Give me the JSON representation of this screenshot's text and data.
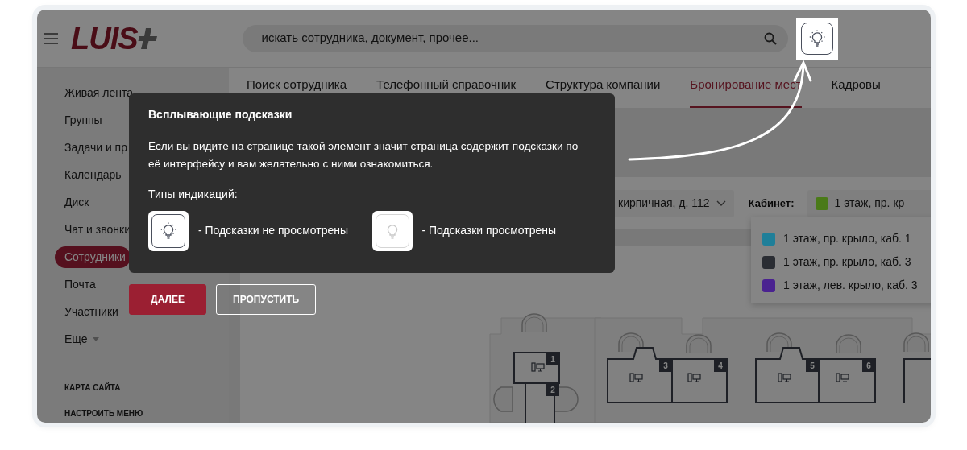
{
  "header": {
    "logo": "LUIS",
    "search": {
      "placeholder": "искать сотрудника, документ, прочее..."
    },
    "hints_button": {
      "viewed": false
    }
  },
  "sidebar": {
    "items": [
      {
        "label": "Живая лента",
        "selected": false,
        "dropdown": false
      },
      {
        "label": "Группы",
        "selected": false,
        "dropdown": false
      },
      {
        "label": "Задачи и пр",
        "selected": false,
        "dropdown": false
      },
      {
        "label": "Календарь",
        "selected": false,
        "dropdown": false
      },
      {
        "label": "Диск",
        "selected": false,
        "dropdown": false
      },
      {
        "label": "Чат и звонки",
        "selected": false,
        "dropdown": false
      },
      {
        "label": "Сотрудники",
        "selected": true,
        "dropdown": false
      },
      {
        "label": "Почта",
        "selected": false,
        "dropdown": false
      },
      {
        "label": "Участники",
        "selected": false,
        "dropdown": false
      },
      {
        "label": "Еще",
        "selected": false,
        "dropdown": true
      }
    ],
    "links": [
      "КАРТА САЙТА",
      "НАСТРОИТЬ МЕНЮ"
    ]
  },
  "tabs": [
    {
      "label": "Поиск сотрудника",
      "selected": false
    },
    {
      "label": "Телефонный справочник",
      "selected": false
    },
    {
      "label": "Структура компании",
      "selected": false
    },
    {
      "label": "Бронирование мест",
      "selected": true
    },
    {
      "label": "Кадровы",
      "selected": false
    }
  ],
  "filters": [
    {
      "value": "кирпичная, д. 112"
    },
    {
      "label": "Кабинет:",
      "value": "1 этаж, пр. кр",
      "color": "#4a7a18"
    }
  ],
  "cabinet_menu": [
    {
      "label": "1 этаж, пр. крыло, каб. 1",
      "color": "#1f7f99"
    },
    {
      "label": "1 этаж, пр. крыло, каб. 3",
      "color": "#2a2d33"
    },
    {
      "label": "1 этаж, лев. крыло, каб. 3",
      "color": "#4a2290"
    }
  ],
  "plan": {
    "desks": [
      "1",
      "2",
      "3",
      "4",
      "5",
      "6"
    ]
  },
  "hint_dialog": {
    "title": "Всплывающие подсказки",
    "text": "Если вы видите на странице такой элемент значит страница содержит подсказки по её интерфейсу и вам желательно с ними ознакомиться.",
    "legend_title": "Типы индикаций:",
    "legend": [
      {
        "viewed": false,
        "label": "- Подсказки не просмотрены"
      },
      {
        "viewed": true,
        "label": "- Подсказки просмотрены"
      }
    ],
    "buttons": [
      {
        "label": "ДАЛЕЕ",
        "kind": "primary"
      },
      {
        "label": "ПРОПУСТИТЬ",
        "kind": "secondary"
      }
    ]
  }
}
